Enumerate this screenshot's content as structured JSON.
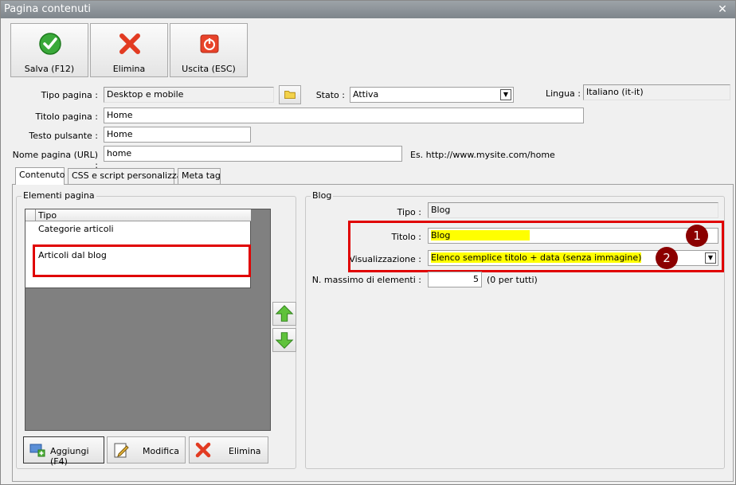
{
  "window": {
    "title": "Pagina contenuti"
  },
  "toolbar": {
    "save_label": "Salva (F12)",
    "delete_label": "Elimina",
    "exit_label": "Uscita (ESC)"
  },
  "form": {
    "page_type_label": "Tipo pagina :",
    "page_type_value": "Desktop e mobile",
    "status_label": "Stato :",
    "status_value": "Attiva",
    "language_label": "Lingua :",
    "language_value": "Italiano (it-it)",
    "page_title_label": "Titolo pagina :",
    "page_title_value": "Home",
    "button_text_label": "Testo pulsante :",
    "button_text_value": "Home",
    "page_name_label": "Nome pagina (URL) :",
    "page_name_value": "home",
    "url_example": "Es. http://www.mysite.com/home"
  },
  "tabs": [
    {
      "label": "Contenuto",
      "active": true
    },
    {
      "label": "CSS e script personalizzati",
      "active": false
    },
    {
      "label": "Meta tag",
      "active": false
    }
  ],
  "elements_panel": {
    "title": "Elementi pagina",
    "column_header": "Tipo",
    "rows": [
      "Categorie articoli",
      "Articoli dal blog"
    ],
    "add_label": "Aggiungi (F4)",
    "edit_label": "Modifica",
    "delete_label": "Elimina"
  },
  "blog_panel": {
    "title": "Blog",
    "type_label": "Tipo :",
    "type_value": "Blog",
    "title_label": "Titolo :",
    "title_value": "Blog",
    "display_label": "Visualizzazione :",
    "display_value": "Elenco semplice titolo + data (senza immagine)",
    "max_label": "N. massimo di elementi :",
    "max_value": "5",
    "max_hint": "(0 per tutti)"
  },
  "annotations": {
    "badge1": "1",
    "badge2": "2"
  },
  "colors": {
    "highlight": "#ffff00",
    "annotation_red": "#e00000",
    "badge": "#8b0000"
  }
}
